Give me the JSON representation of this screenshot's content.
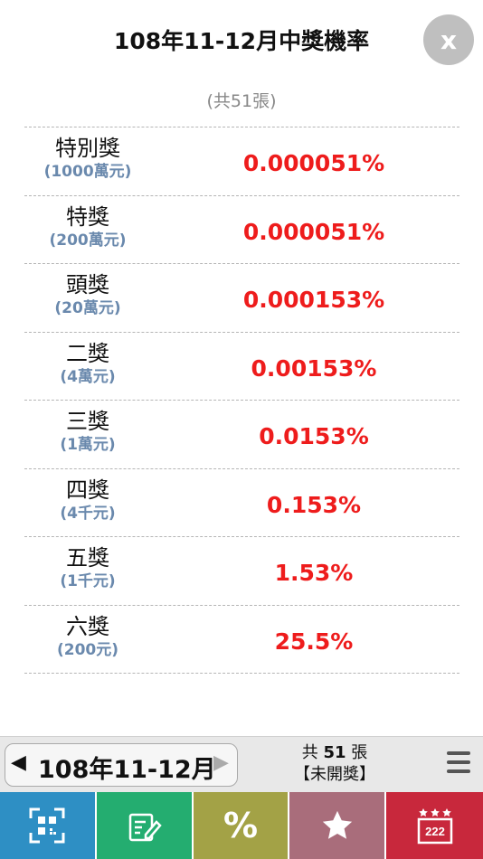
{
  "header": {
    "title": "108年11-12月中獎機率",
    "close_label": "x"
  },
  "summary": {
    "count_text": "(共51張)"
  },
  "prizes": [
    {
      "name": "特別獎",
      "amount": "(1000萬元)",
      "probability": "0.000051%"
    },
    {
      "name": "特獎",
      "amount": "(200萬元)",
      "probability": "0.000051%"
    },
    {
      "name": "頭獎",
      "amount": "(20萬元)",
      "probability": "0.000153%"
    },
    {
      "name": "二獎",
      "amount": "(4萬元)",
      "probability": "0.00153%"
    },
    {
      "name": "三獎",
      "amount": "(1萬元)",
      "probability": "0.0153%"
    },
    {
      "name": "四獎",
      "amount": "(4千元)",
      "probability": "0.153%"
    },
    {
      "name": "五獎",
      "amount": "(1千元)",
      "probability": "1.53%"
    },
    {
      "name": "六獎",
      "amount": "(200元)",
      "probability": "25.5%"
    }
  ],
  "bottom_bar": {
    "prev_arrow": "◀",
    "period": "108年11-12月",
    "next_arrow": "▶",
    "ticket_prefix": "共",
    "ticket_count": "51",
    "ticket_suffix": "張",
    "status": "【未開獎】"
  },
  "tabs": [
    {
      "icon": "qr-scan-icon",
      "color": "#2e8fc4"
    },
    {
      "icon": "edit-note-icon",
      "color": "#24ad70"
    },
    {
      "icon": "percent-icon",
      "label": "%",
      "color": "#a3a246"
    },
    {
      "icon": "star-icon",
      "color": "#a96d7b"
    },
    {
      "icon": "lottery-222-icon",
      "label": "222",
      "color": "#c8283c"
    }
  ]
}
